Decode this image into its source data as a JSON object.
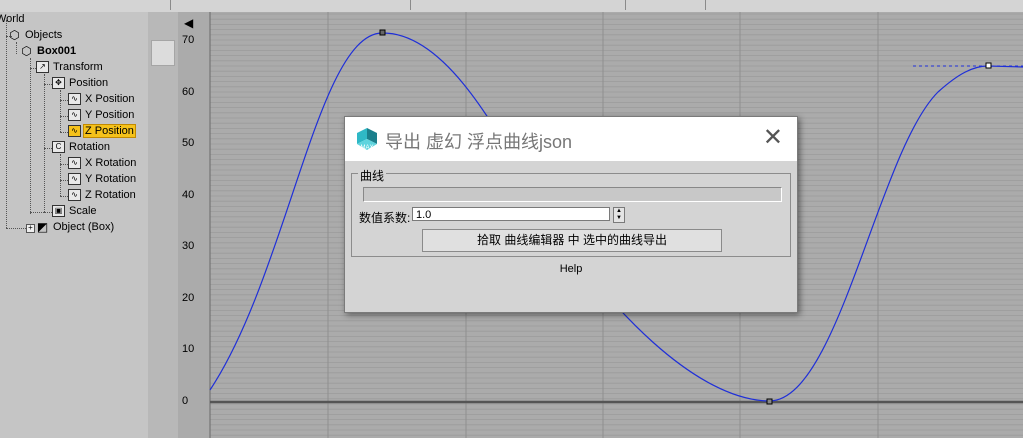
{
  "tree": {
    "items": [
      {
        "label": "World"
      },
      {
        "label": "Objects"
      },
      {
        "label": "Box001"
      },
      {
        "label": "Transform"
      },
      {
        "label": "Position"
      },
      {
        "label": "X Position"
      },
      {
        "label": "Y Position"
      },
      {
        "label": "Z Position"
      },
      {
        "label": "Rotation"
      },
      {
        "label": "X Rotation"
      },
      {
        "label": "Y Rotation"
      },
      {
        "label": "Z Rotation"
      },
      {
        "label": "Scale"
      },
      {
        "label": "Object (Box)"
      }
    ],
    "selected": "Z Position"
  },
  "graph": {
    "y_ticks": [
      "70",
      "60",
      "50",
      "40",
      "30",
      "20",
      "10",
      "0"
    ],
    "curve_color": "#1f2fd8"
  },
  "dialog": {
    "title": "导出 虚幻 浮点曲线json",
    "close_glyph": "✕",
    "group_label": "曲线",
    "multiplier_label": "数值系数:",
    "multiplier_value": "1.0",
    "pick_button": "拾取 曲线编辑器 中 选中的曲线导出",
    "help": "Help",
    "icon_text": "MAX"
  }
}
